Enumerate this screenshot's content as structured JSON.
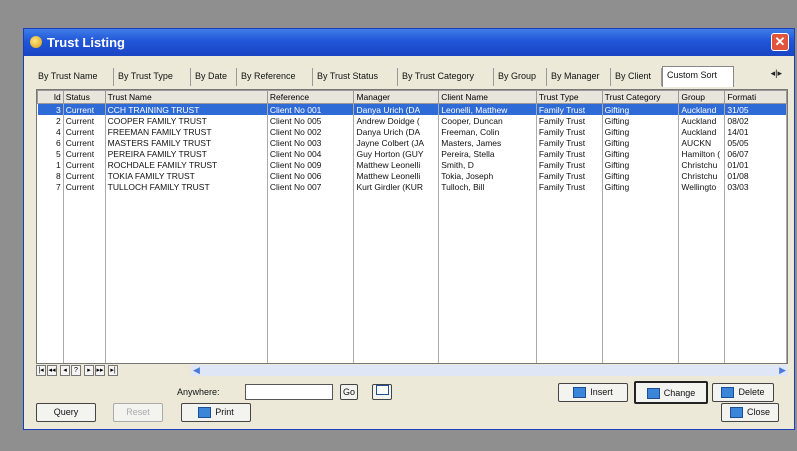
{
  "window": {
    "title": "Trust Listing"
  },
  "tabs": [
    "By Trust Name",
    "By Trust Type",
    "By Date",
    "By Reference",
    "By Trust Status",
    "By Trust Category",
    "By Group",
    "By Manager",
    "By Client",
    "Custom Sort"
  ],
  "active_tab": "Custom Sort",
  "grid": {
    "columns": [
      "Id",
      "Status",
      "Trust Name",
      "Reference",
      "Manager",
      "Client Name",
      "Trust Type",
      "Trust Category",
      "Group",
      "Formati"
    ],
    "rows": [
      [
        "3",
        "Current",
        "CCH TRAINING TRUST",
        "Client No 001",
        "Danya Urich (DA",
        "Leonelli, Matthew",
        "Family Trust",
        "Gifting",
        "Auckland",
        "31/05"
      ],
      [
        "2",
        "Current",
        "COOPER FAMILY TRUST",
        "Client No 005",
        "Andrew Doidge (",
        "Cooper, Duncan",
        "Family Trust",
        "Gifting",
        "Auckland",
        "08/02"
      ],
      [
        "4",
        "Current",
        "FREEMAN FAMILY TRUST",
        "Client No 002",
        "Danya Urich (DA",
        "Freeman, Colin",
        "Family Trust",
        "Gifting",
        "Auckland",
        "14/01"
      ],
      [
        "6",
        "Current",
        "MASTERS FAMILY TRUST",
        "Client No 003",
        "Jayne Colbert (JA",
        "Masters, James",
        "Family Trust",
        "Gifting",
        "AUCKN",
        "05/05"
      ],
      [
        "5",
        "Current",
        "PEREIRA FAMILY TRUST",
        "Client No 004",
        "Guy Horton (GUY",
        "Pereira, Stella",
        "Family Trust",
        "Gifting",
        "Hamilton (",
        "06/07"
      ],
      [
        "1",
        "Current",
        "ROCHDALE FAMILY TRUST",
        "Client No 009",
        "Matthew Leonelli",
        "Smith, D",
        "Family Trust",
        "Gifting",
        "Christchu",
        "01/01"
      ],
      [
        "8",
        "Current",
        "TOKIA FAMILY TRUST",
        "Client No 006",
        "Matthew Leonelli",
        "Tokia, Joseph",
        "Family Trust",
        "Gifting",
        "Christchu",
        "01/08"
      ],
      [
        "7",
        "Current",
        "TULLOCH FAMILY TRUST",
        "Client No 007",
        "Kurt Girdler (KUR",
        "Tulloch, Bill",
        "Family Trust",
        "Gifting",
        "Wellingto",
        "03/03"
      ]
    ],
    "selected_row": 0
  },
  "nav_buttons": [
    "|◂",
    "◂◂",
    "◂",
    "?",
    "▸",
    "▸▸",
    "▸|"
  ],
  "search": {
    "label": "Anywhere:",
    "value": "",
    "go_label": "Go"
  },
  "actions": {
    "insert": "Insert",
    "change": "Change",
    "delete": "Delete"
  },
  "bottom": {
    "query": "Query",
    "reset": "Reset",
    "print": "Print",
    "close": "Close"
  },
  "colors": {
    "titlebar": "#2055d8",
    "selection": "#2f6bd6",
    "window_bg": "#ece9d8"
  }
}
